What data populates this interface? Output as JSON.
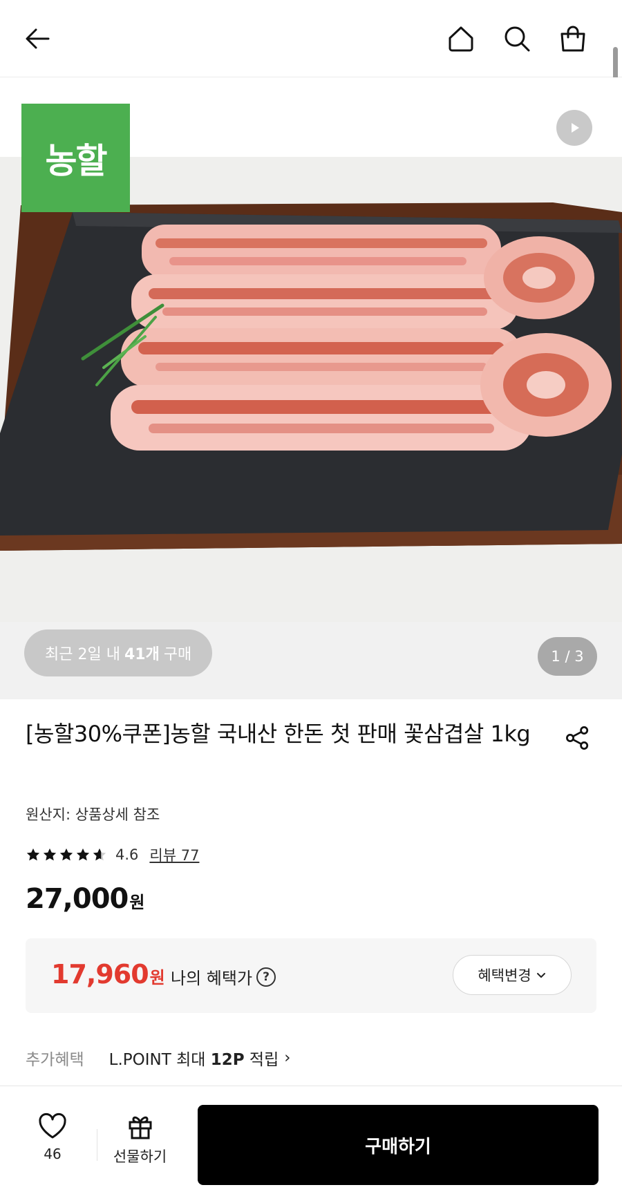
{
  "header": {
    "back_icon": "arrow-left-icon",
    "home_icon": "home-icon",
    "search_icon": "search-icon",
    "cart_icon": "shopping-bag-icon"
  },
  "media": {
    "brand_badge": "농할",
    "recent_prefix": "최근 2일 내",
    "recent_count": "41개",
    "recent_suffix": "구매",
    "counter": "1 / 3",
    "play_icon": "play-icon",
    "badge_color": "#4caf50"
  },
  "product": {
    "title": "[농할30%쿠폰]농할 국내산 한돈 첫 판매 꽃삼겹살 1kg",
    "origin": "원산지: 상품상세 참조",
    "rating": "4.6",
    "rating_value": 4.6,
    "review_link": "리뷰 77",
    "price": "27,000",
    "price_unit": "원"
  },
  "benefit": {
    "price": "17,960",
    "price_unit": "원",
    "label": "나의 혜택가",
    "help": "?",
    "change_button": "혜택변경",
    "accent_color": "#e23a2f"
  },
  "extra": {
    "label": "추가혜택",
    "value_prefix": "L.POINT 최대",
    "value_bold": "12P",
    "value_suffix": "적립",
    "chevron": "›"
  },
  "bottom_bar": {
    "wish_count": "46",
    "gift_label": "선물하기",
    "buy_label": "구매하기"
  }
}
